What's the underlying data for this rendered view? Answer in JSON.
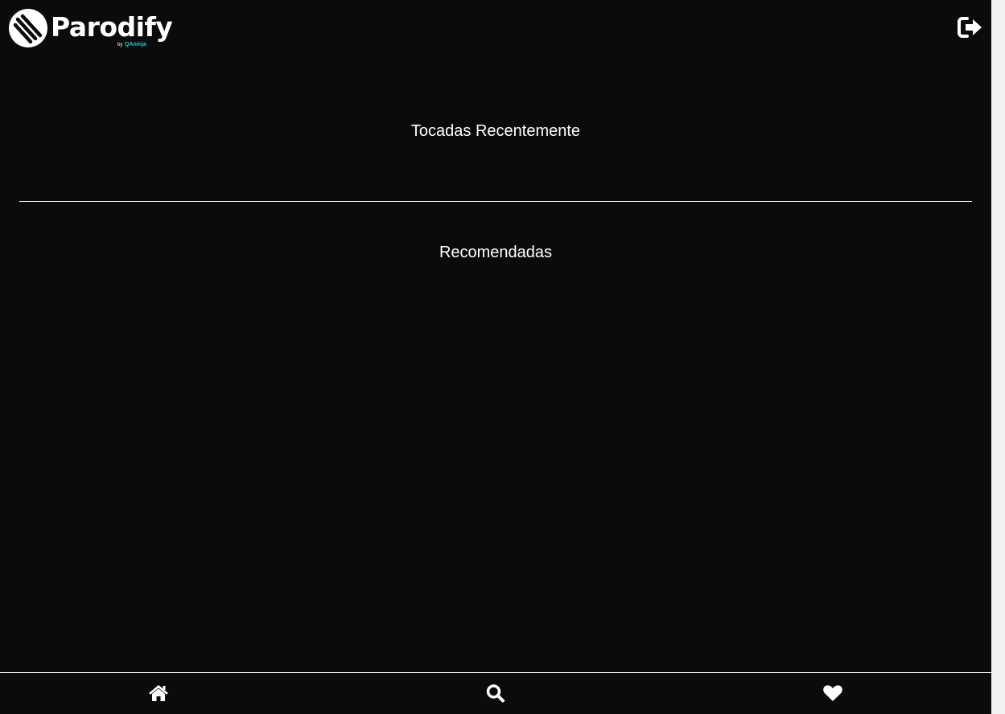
{
  "header": {
    "brand": "Parodify",
    "brand_by": "by",
    "brand_sub": "QAninja",
    "logout_icon": "sign-out-icon"
  },
  "main": {
    "recent_title": "Tocadas Recentemente",
    "recommended_title": "Recomendadas"
  },
  "bottom_nav": {
    "items": [
      {
        "icon": "home-icon"
      },
      {
        "icon": "search-icon"
      },
      {
        "icon": "heart-icon"
      }
    ]
  },
  "colors": {
    "background": "#0b0b0b",
    "text": "#ffffff",
    "brand_accent": "#2ec4c0"
  }
}
